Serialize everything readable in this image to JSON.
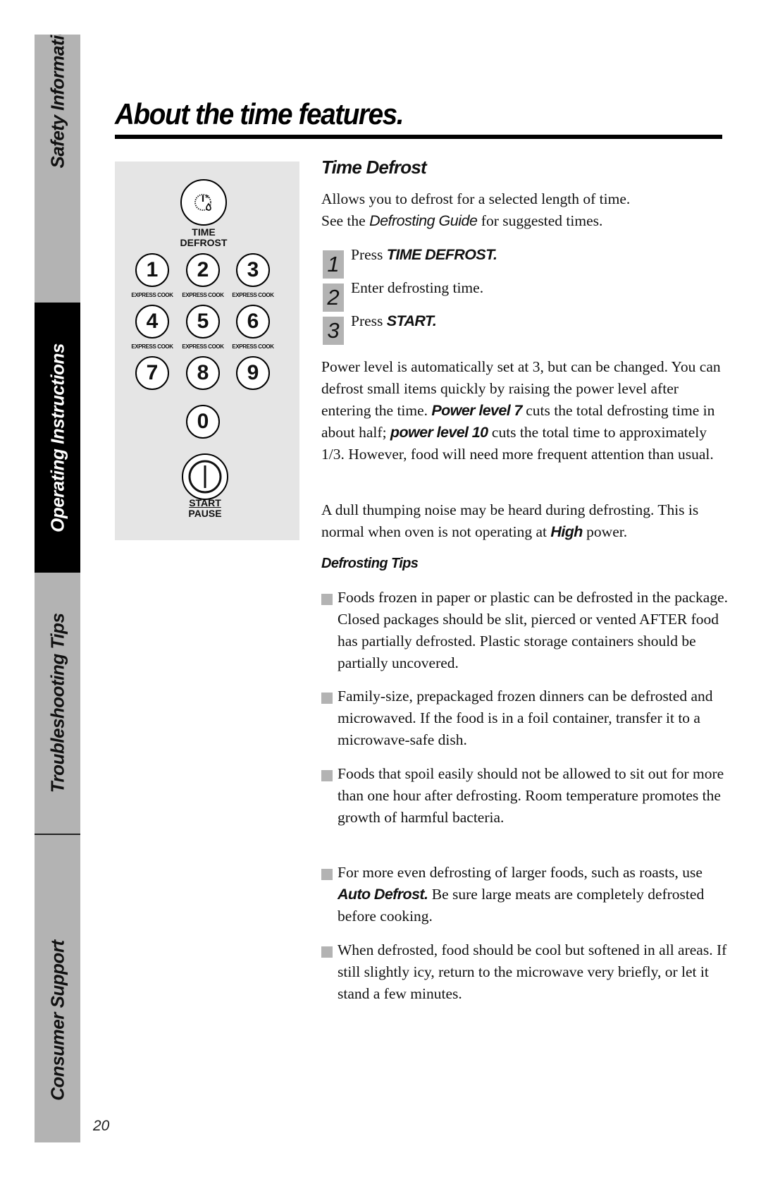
{
  "sidebar": {
    "tabs": [
      {
        "label": "Safety Information",
        "active": false
      },
      {
        "label": "Operating Instructions",
        "active": true
      },
      {
        "label": "Troubleshooting Tips",
        "active": false
      },
      {
        "label": "Consumer Support",
        "active": false
      }
    ]
  },
  "page": {
    "title": "About the time features.",
    "number": "20"
  },
  "keypad": {
    "time_defrost_icon": "clock-snowflake-drop-icon",
    "time_defrost_label_1": "TIME",
    "time_defrost_label_2": "DEFROST",
    "keys": [
      "1",
      "2",
      "3",
      "4",
      "5",
      "6",
      "7",
      "8",
      "9",
      "0"
    ],
    "express_cook_label": "EXPRESS COOK",
    "start_icon": "power-start-icon",
    "start_label": "START",
    "pause_label": "PAUSE"
  },
  "time_defrost": {
    "heading": "Time Defrost",
    "intro_line1": "Allows you to defrost for a selected length of time.",
    "intro_line2_pre": "See the ",
    "intro_line2_em": "Defrosting Guide",
    "intro_line2_post": " for suggested times.",
    "steps": [
      {
        "number": "1",
        "text": "Press ",
        "emphasis": "TIME DEFROST."
      },
      {
        "number": "2",
        "text": "Enter defrosting time.",
        "emphasis": ""
      },
      {
        "number": "3",
        "text": "Press ",
        "emphasis": "START."
      }
    ],
    "power_para": {
      "part1": "Power level is automatically set at 3, but can be changed. You can defrost small items quickly by raising the power level after entering the time. ",
      "em1": "Power level 7",
      "part2": "  cuts the total defrosting time in about half; ",
      "em2": "power level 10",
      "part3": "  cuts the total time to approximately 1/3. However, food will need more frequent attention than usual."
    },
    "noise_para": {
      "part1": "A dull thumping noise may be heard during defrosting. This is normal when oven is not operating at ",
      "em": "High",
      "part2": " power."
    }
  },
  "defrosting_tips": {
    "heading": "Defrosting Tips",
    "items": [
      {
        "pre": "Foods frozen in paper or plastic can be defrosted in the package. Closed packages should be slit, pierced or vented AFTER food has partially defrosted. Plastic storage containers should be partially uncovered.",
        "em": "",
        "post": ""
      },
      {
        "pre": "Family-size, prepackaged frozen dinners can be defrosted and microwaved. If the food is in a foil container, transfer it to a microwave-safe dish.",
        "em": "",
        "post": ""
      },
      {
        "pre": "Foods that spoil easily should not be allowed to sit out for more than one hour after defrosting. Room temperature promotes the growth of harmful bacteria.",
        "em": "",
        "post": ""
      },
      {
        "pre": "For more even defrosting of larger foods, such as roasts, use ",
        "em": "Auto Defrost.",
        "post": " Be sure large meats are completely defrosted before cooking."
      },
      {
        "pre": "When defrosted, food should be cool but softened in all areas. If still slightly icy, return to the microwave very briefly, or let it stand a few minutes.",
        "em": "",
        "post": ""
      }
    ]
  },
  "colors": {
    "tab_gray": "#b3b3b3",
    "tab_active": "#000000",
    "panel_gray": "#e5e5e5",
    "bullet_gray": "#b3b3b3"
  }
}
